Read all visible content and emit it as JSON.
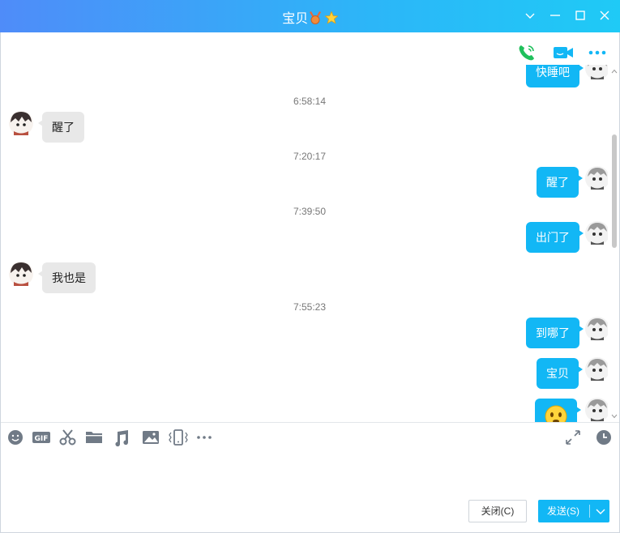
{
  "window": {
    "title": "宝贝",
    "badge_icons": [
      "medal-icon",
      "star-icon"
    ]
  },
  "toolbar_top": {
    "icons": [
      "voice-call-icon",
      "video-call-icon",
      "more-icon"
    ]
  },
  "messages": [
    {
      "direction": "out",
      "text": "快睡吧"
    },
    {
      "type": "time",
      "text": "6:58:14"
    },
    {
      "direction": "in",
      "text": "醒了"
    },
    {
      "type": "time",
      "text": "7:20:17"
    },
    {
      "direction": "out",
      "text": "醒了"
    },
    {
      "type": "time",
      "text": "7:39:50"
    },
    {
      "direction": "out",
      "text": "出门了"
    },
    {
      "direction": "in",
      "text": "我也是"
    },
    {
      "type": "time",
      "text": "7:55:23"
    },
    {
      "direction": "out",
      "text": "到哪了"
    },
    {
      "direction": "out",
      "text": "宝贝"
    },
    {
      "direction": "out",
      "type": "emoji",
      "emoji": "smile-emoji-icon"
    }
  ],
  "input_toolbar": {
    "left_icons": [
      "emoji-icon",
      "gif-icon",
      "scissors-icon",
      "folder-icon",
      "music-icon",
      "image-icon",
      "shake-icon",
      "more-icon"
    ],
    "gif_label": "GIF",
    "right_icons": [
      "expand-icon",
      "history-icon"
    ]
  },
  "input": {
    "value": "",
    "placeholder": ""
  },
  "buttons": {
    "close_label": "关闭(C)",
    "send_label": "发送(S)"
  },
  "colors": {
    "accent": "#12b7f5",
    "title_gradient_start": "#4f8cf9",
    "title_gradient_end": "#1fcaf6",
    "call_green": "#20c05c",
    "incoming_bubble": "#e8e8e8"
  }
}
